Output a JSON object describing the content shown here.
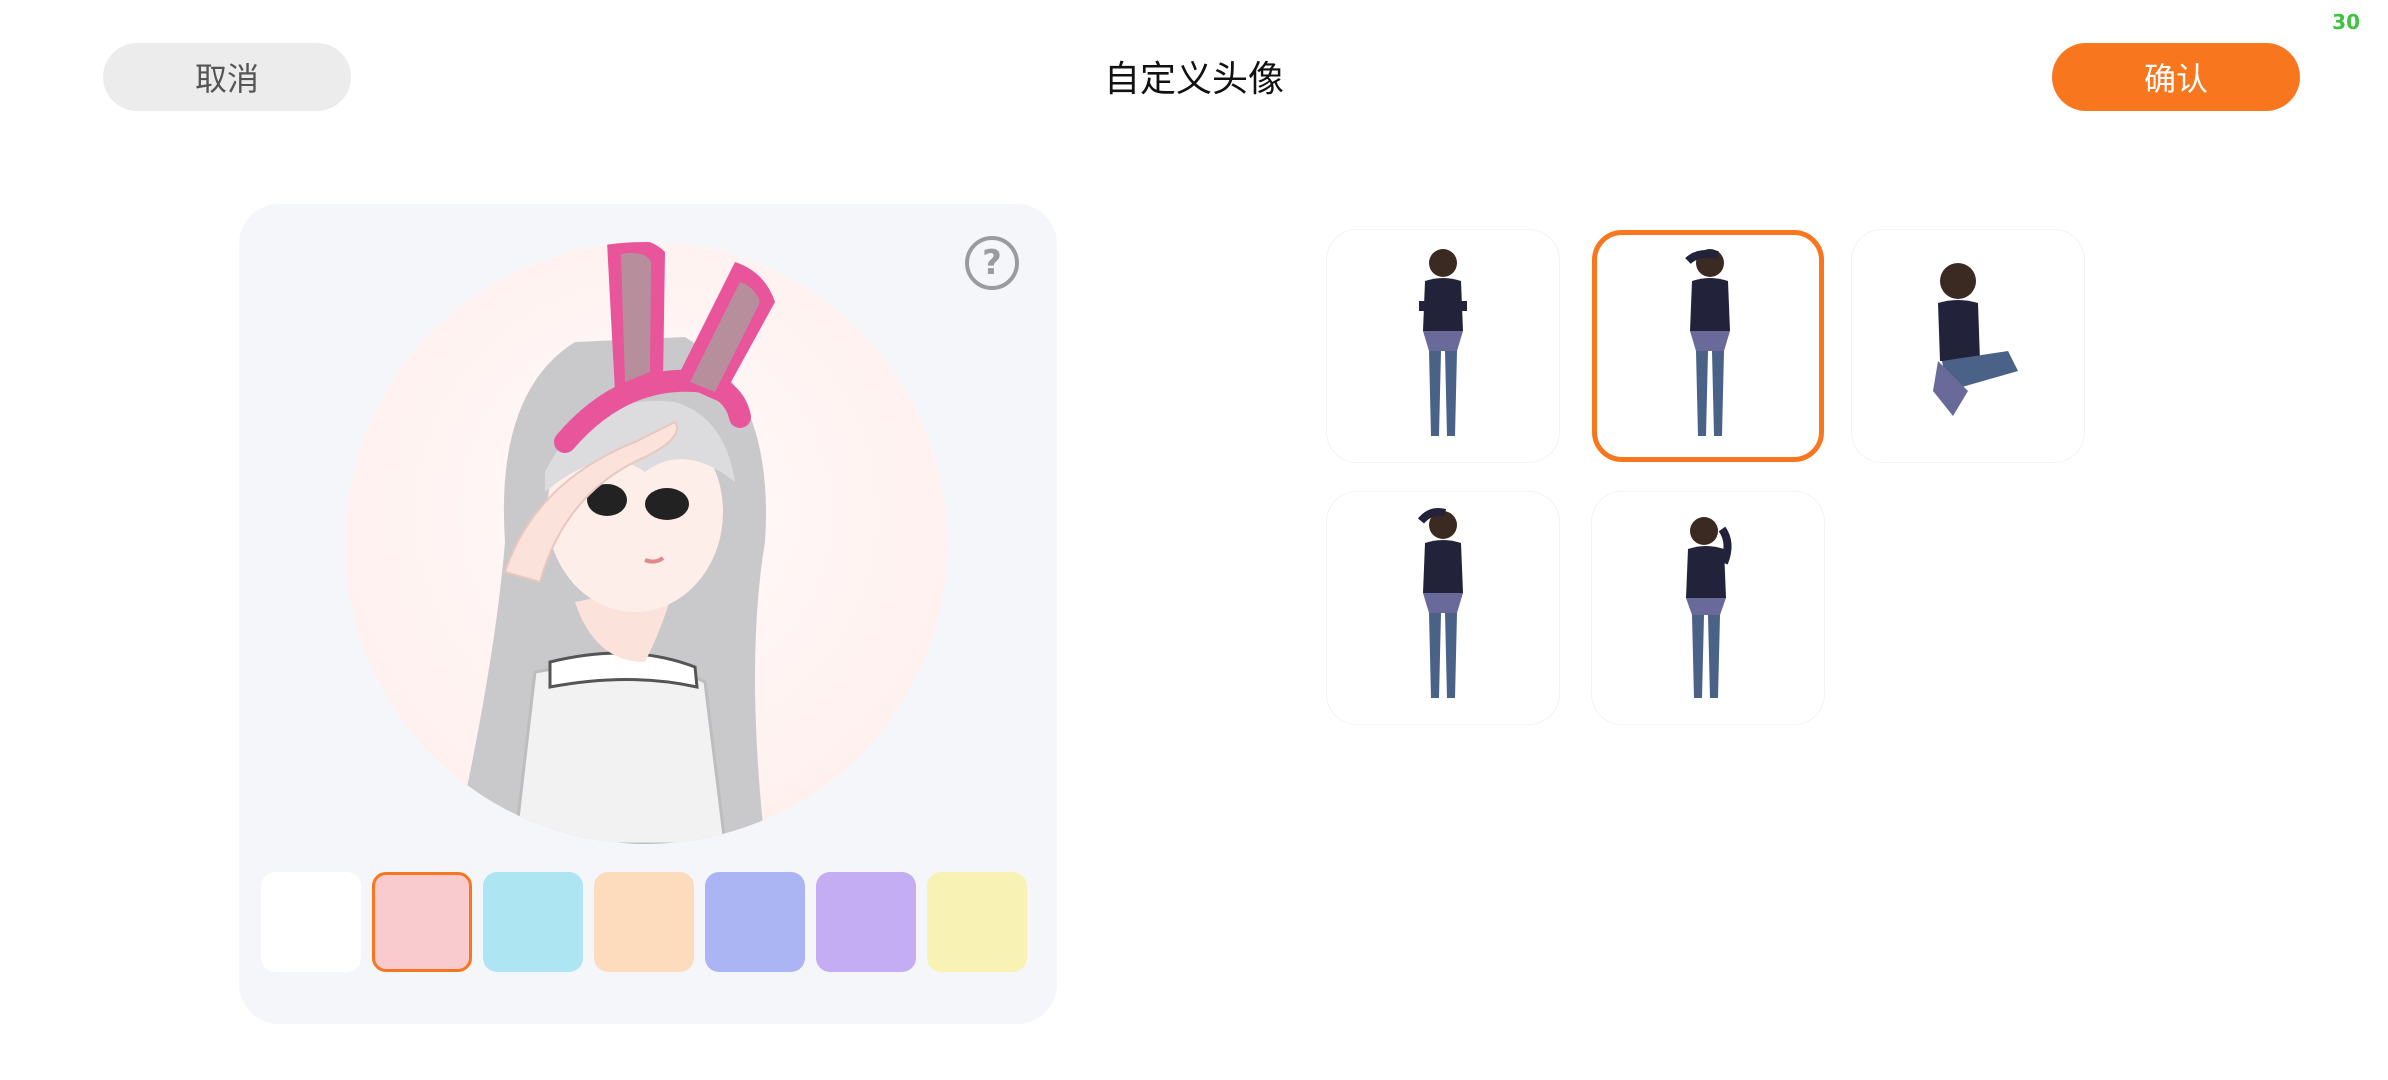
{
  "status": {
    "fps": "30"
  },
  "header": {
    "cancel_label": "取消",
    "title": "自定义头像",
    "confirm_label": "确认"
  },
  "preview": {
    "help_glyph": "?",
    "accent_color": "#f7761e",
    "background_swatches": [
      {
        "color": "#ffffff",
        "selected": false
      },
      {
        "color": "#f9cbcf",
        "selected": true
      },
      {
        "color": "#ade5f3",
        "selected": false
      },
      {
        "color": "#fddcbd",
        "selected": false
      },
      {
        "color": "#abb5f3",
        "selected": false
      },
      {
        "color": "#c4adf3",
        "selected": false
      },
      {
        "color": "#f8f3b5",
        "selected": false
      },
      {
        "color": "#b5f0f8",
        "selected": false
      }
    ]
  },
  "poses": [
    {
      "name": "pose-arms-crossed",
      "selected": false
    },
    {
      "name": "pose-salute",
      "selected": true
    },
    {
      "name": "pose-sitting",
      "selected": false
    },
    {
      "name": "pose-hand-on-head",
      "selected": false
    },
    {
      "name": "pose-hand-on-hip",
      "selected": false
    }
  ]
}
